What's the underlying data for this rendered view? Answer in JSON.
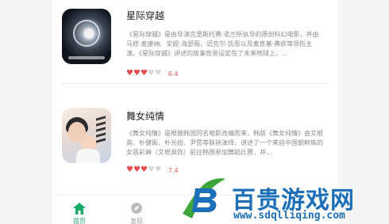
{
  "list": [
    {
      "title": "星际穿越",
      "description": "《星际穿越》是由导演克里斯托弗·诺兰所执导的原创科幻电影，并由马修·麦康纳、安妮·海瑟薇、迈克尔·凯恩以及麦肯基·弗依等领衔主演。《星际穿越》讲述的故事背景设定在了未来地球上，...",
      "rating_hearts_filled": 3,
      "rating_hearts_total": 5,
      "score": "6.4"
    },
    {
      "title": "舞女纯情",
      "description": "《舞女纯情》是根据韩国同名电影改编而来，韩版《舞女纯情》由文根英、朴健衙、朴元尚、尹赞等联袂演绎，讲述了一个来自中国朝鲜族的女孩彩琳（文根英饰）前往韩国参加舞蹈比赛，并...",
      "rating_hearts_filled": 3.5,
      "rating_hearts_total": 5,
      "score": "7.4"
    }
  ],
  "tabbar": {
    "home_label": "首页",
    "discover_label": "发现"
  },
  "watermark": {
    "title": "百贵游戏网",
    "url": "www.sdqlliqing.com"
  },
  "colors": {
    "accent_green": "#1aa86b",
    "heart_red": "#e74c4c",
    "watermark_blue": "#1c6fb8"
  }
}
